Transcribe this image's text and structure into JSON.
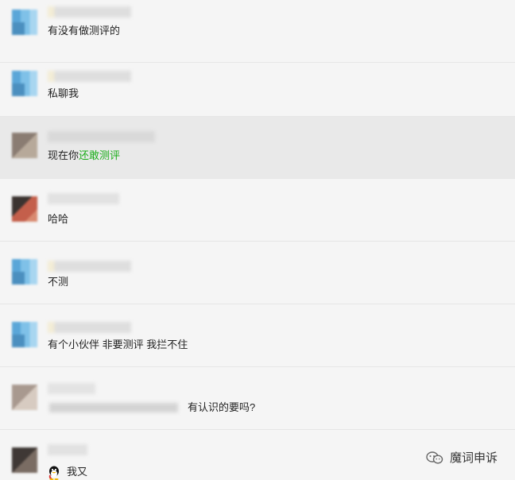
{
  "messages": [
    {
      "text": "有没有做测评的"
    },
    {
      "text": "私聊我"
    },
    {
      "text_plain": "现在你",
      "text_green": "还敢测评",
      "highlight": true
    },
    {
      "text": "哈哈"
    },
    {
      "text": "不测"
    },
    {
      "text": "有个小伙伴  非要测评 我拦不住"
    },
    {
      "text": "有认识的要吗?"
    },
    {
      "text": "我又"
    }
  ],
  "watermark": {
    "label": "魔词申诉",
    "icon": "wechat-official-account-icon"
  },
  "colors": {
    "green": "#1aad19",
    "highlight_row": "#e9e9e9"
  }
}
